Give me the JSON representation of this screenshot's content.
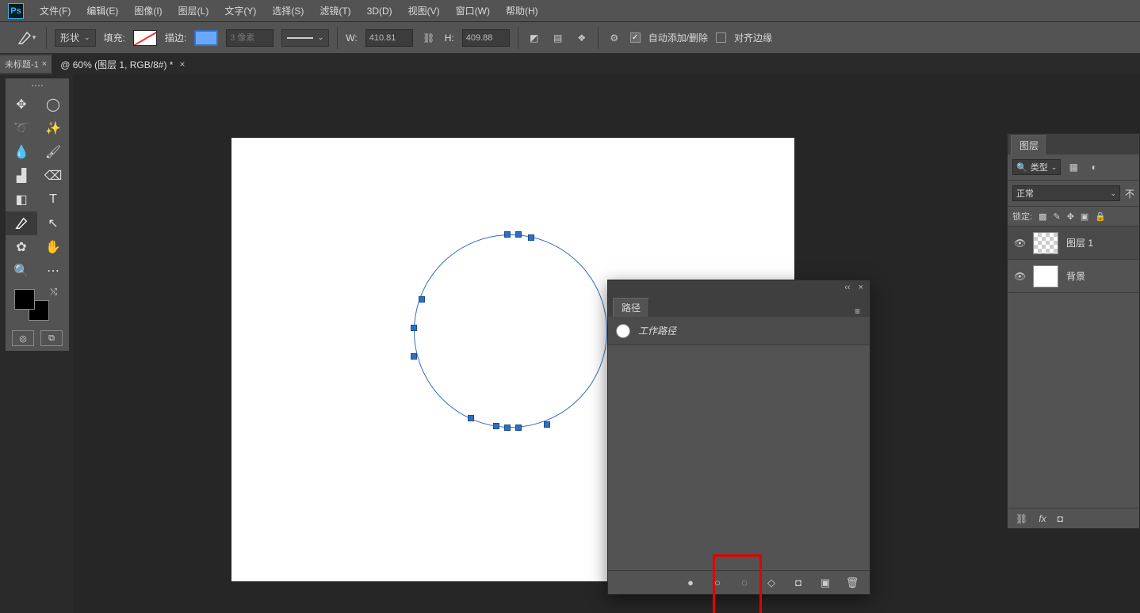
{
  "menu": {
    "items": [
      "文件(F)",
      "编辑(E)",
      "图像(I)",
      "图层(L)",
      "文字(Y)",
      "选择(S)",
      "滤镜(T)",
      "3D(D)",
      "视图(V)",
      "窗口(W)",
      "帮助(H)"
    ]
  },
  "options": {
    "mode_label": "形状",
    "fill_label": "填充:",
    "stroke_label": "描边:",
    "stroke_size_placeholder": "3 像素",
    "w_label": "W:",
    "w_value": "410.81",
    "h_label": "H:",
    "h_value": "409.88",
    "auto_add_label": "自动添加/删除",
    "auto_add_checked": true,
    "align_edges_label": "对齐边缘",
    "align_edges_checked": false
  },
  "doc": {
    "mini_tab": "未标题-1",
    "tab_title": "@ 60% (图层 1, RGB/8#) *"
  },
  "paths_panel": {
    "tab": "路径",
    "item": "工作路径"
  },
  "layers_panel": {
    "tab": "图层",
    "kind_label": "类型",
    "blend_mode": "正常",
    "opacity_suffix": "不",
    "lock_label": "锁定:",
    "layers": [
      {
        "name": "图层 1",
        "selected": true,
        "checker": true
      },
      {
        "name": "背景",
        "selected": false,
        "checker": false
      }
    ]
  },
  "icons": {
    "search": "🔍",
    "link": "⛓",
    "gear": "⚙",
    "eye": "👁",
    "fx": "fx",
    "trash": "🗑",
    "menu": "≡",
    "collapse": "‹‹",
    "close": "×"
  }
}
